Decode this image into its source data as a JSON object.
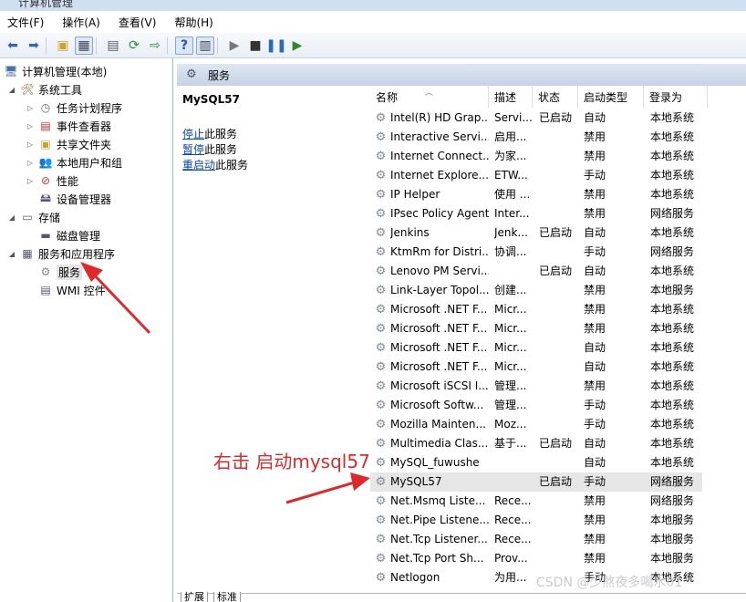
{
  "window": {
    "title": "计算机管理"
  },
  "menu": [
    "文件(F)",
    "操作(A)",
    "查看(V)",
    "帮助(H)"
  ],
  "toolbar": {
    "icons": [
      "back-icon",
      "forward-icon",
      "up-folder-icon",
      "show-tree-icon",
      "properties-icon",
      "refresh-icon",
      "export-icon",
      "help-icon",
      "action-pane-icon",
      "start-icon",
      "stop-icon",
      "pause-icon",
      "resume-icon"
    ]
  },
  "tree": {
    "root": "计算机管理(本地)",
    "system_tools": "系统工具",
    "task_scheduler": "任务计划程序",
    "event_viewer": "事件查看器",
    "shared_folders": "共享文件夹",
    "local_users": "本地用户和组",
    "performance": "性能",
    "device_manager": "设备管理器",
    "storage": "存储",
    "disk_mgmt": "磁盘管理",
    "services_apps": "服务和应用程序",
    "services": "服务",
    "wmi": "WMI 控件"
  },
  "header": {
    "title": "服务"
  },
  "details": {
    "service_name": "MySQL57",
    "actions": [
      {
        "link": "停止",
        "suffix": "此服务"
      },
      {
        "link": "暂停",
        "suffix": "此服务"
      },
      {
        "link": "重启动",
        "suffix": "此服务"
      }
    ]
  },
  "columns": {
    "name": "名称",
    "desc": "描述",
    "status": "状态",
    "startup": "启动类型",
    "logon": "登录为"
  },
  "services": [
    {
      "name": "Intel(R) HD Grap...",
      "desc": "Servi...",
      "status": "已启动",
      "startup": "自动",
      "logon": "本地系统"
    },
    {
      "name": "Interactive Servi...",
      "desc": "启用...",
      "status": "",
      "startup": "禁用",
      "logon": "本地系统"
    },
    {
      "name": "Internet Connect...",
      "desc": "为家...",
      "status": "",
      "startup": "禁用",
      "logon": "本地系统"
    },
    {
      "name": "Internet Explore...",
      "desc": "ETW...",
      "status": "",
      "startup": "手动",
      "logon": "本地系统"
    },
    {
      "name": "IP Helper",
      "desc": "使用 ...",
      "status": "",
      "startup": "禁用",
      "logon": "本地系统"
    },
    {
      "name": "IPsec Policy Agent",
      "desc": "Inter...",
      "status": "",
      "startup": "禁用",
      "logon": "网络服务"
    },
    {
      "name": "Jenkins",
      "desc": "Jenk...",
      "status": "已启动",
      "startup": "自动",
      "logon": "本地系统"
    },
    {
      "name": "KtmRm for Distri...",
      "desc": "协调...",
      "status": "",
      "startup": "手动",
      "logon": "网络服务"
    },
    {
      "name": "Lenovo PM Servi...",
      "desc": "",
      "status": "已启动",
      "startup": "自动",
      "logon": "本地系统"
    },
    {
      "name": "Link-Layer Topol...",
      "desc": "创建...",
      "status": "",
      "startup": "禁用",
      "logon": "本地服务"
    },
    {
      "name": "Microsoft .NET F...",
      "desc": "Micr...",
      "status": "",
      "startup": "禁用",
      "logon": "本地系统"
    },
    {
      "name": "Microsoft .NET F...",
      "desc": "Micr...",
      "status": "",
      "startup": "禁用",
      "logon": "本地系统"
    },
    {
      "name": "Microsoft .NET F...",
      "desc": "Micr...",
      "status": "",
      "startup": "自动",
      "logon": "本地系统"
    },
    {
      "name": "Microsoft .NET F...",
      "desc": "Micr...",
      "status": "",
      "startup": "自动",
      "logon": "本地系统"
    },
    {
      "name": "Microsoft iSCSI I...",
      "desc": "管理...",
      "status": "",
      "startup": "禁用",
      "logon": "本地系统"
    },
    {
      "name": "Microsoft Softw...",
      "desc": "管理...",
      "status": "",
      "startup": "手动",
      "logon": "本地系统"
    },
    {
      "name": "Mozilla Mainten...",
      "desc": "Moz...",
      "status": "",
      "startup": "手动",
      "logon": "本地系统"
    },
    {
      "name": "Multimedia Clas...",
      "desc": "基于...",
      "status": "已启动",
      "startup": "自动",
      "logon": "本地系统"
    },
    {
      "name": "MySQL_fuwushe",
      "desc": "",
      "status": "",
      "startup": "自动",
      "logon": "本地系统"
    },
    {
      "name": "MySQL57",
      "desc": "",
      "status": "已启动",
      "startup": "手动",
      "logon": "网络服务"
    },
    {
      "name": "Net.Msmq Liste...",
      "desc": "Rece...",
      "status": "",
      "startup": "禁用",
      "logon": "网络服务"
    },
    {
      "name": "Net.Pipe Listene...",
      "desc": "Rece...",
      "status": "",
      "startup": "禁用",
      "logon": "本地服务"
    },
    {
      "name": "Net.Tcp Listener...",
      "desc": "Rece...",
      "status": "",
      "startup": "禁用",
      "logon": "本地服务"
    },
    {
      "name": "Net.Tcp Port Sh...",
      "desc": "Prov...",
      "status": "",
      "startup": "禁用",
      "logon": "本地服务"
    },
    {
      "name": "Netlogon",
      "desc": "为用...",
      "status": "",
      "startup": "手动",
      "logon": "本地系统"
    }
  ],
  "selected_index": 19,
  "tabs": [
    "扩展",
    "标准"
  ],
  "annotation": "右击 启动mysql57",
  "watermark": "CSDN @少熬夜多喝水01",
  "colors": {
    "accent_arrow": "#e0282a",
    "link": "#0645ad",
    "selected_row": "#e6e6e6"
  }
}
